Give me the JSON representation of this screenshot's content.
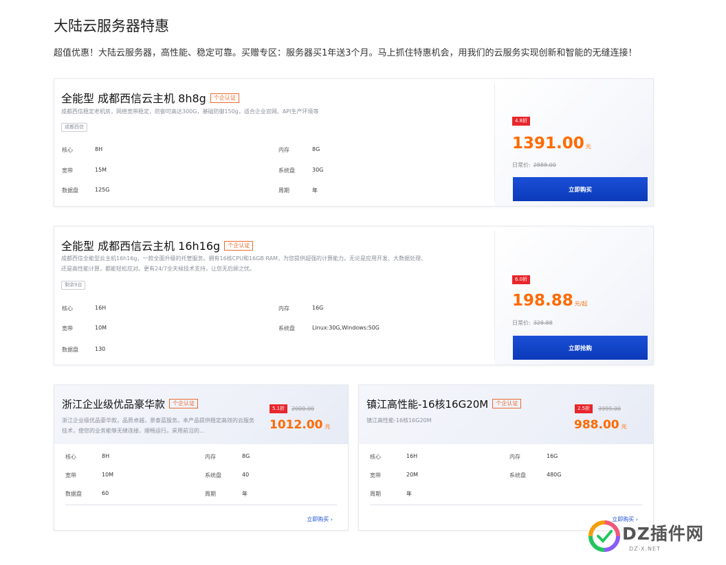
{
  "page": {
    "title": "大陆云服务器特惠",
    "subtitle": "超值优惠！大陆云服务器，高性能、稳定可靠。买赠专区：服务器买1年送3个月。马上抓住特惠机会，用我们的云服务实现创新和智能的无缝连接！"
  },
  "products": [
    {
      "name": "全能型 成都西信云主机 8h8g",
      "badge": "个企认证",
      "desc": "成都西信稳定老机房，网络宽带稳定，防御可高达300G，基础防御150g，适合企业官网、API生产环境等",
      "tag": "成都西信",
      "specs": {
        "core_k": "核心",
        "core_v": "8H",
        "mem_k": "内存",
        "mem_v": "8G",
        "bw_k": "宽带",
        "bw_v": "15M",
        "sys_k": "系统盘",
        "sys_v": "30G",
        "data_k": "数据盘",
        "data_v": "125G",
        "period_k": "周期",
        "period_v": "年"
      },
      "discount": "4.8折",
      "price": "1391.00",
      "unit": "元",
      "orig_label": "日常价:",
      "orig_price": "2888.00",
      "buy": "立即购买"
    },
    {
      "name": "全能型 成都西信云主机 16h16g",
      "badge": "个企认证",
      "desc1": "成都西信全能型云主机16h16g，一款全面升级的托管服务。拥有16核CPU和16GB RAM，为您提供超强的计算能力。无论是应用开发、大数据处理、",
      "desc2": "还是高性能计算，都能轻松应对。更有24/7全天候技术支持，让您无后顾之忧。",
      "tag": "剩余9台",
      "specs": {
        "core_k": "核心",
        "core_v": "16H",
        "mem_k": "内存",
        "mem_v": "16G",
        "bw_k": "宽带",
        "bw_v": "10M",
        "sys_k": "系统盘",
        "sys_v": "Linux:30G,Windows:50G",
        "data_k": "数据盘",
        "data_v": "130"
      },
      "discount": "6.0折",
      "price": "198.88",
      "unit": "元/起",
      "orig_label": "日常价:",
      "orig_price": "328.88",
      "buy": "立即抢购"
    }
  ],
  "small_products": [
    {
      "name": "浙江企业级优品豪华款",
      "badge": "个企认证",
      "desc": "浙江企业级优品豪华款，品质卓越，景泰蓝服务。本产品提供稳定高效的云服务技术，使您的业务能够无缝连接，顺畅运行。采用前沿的...",
      "discount": "5.1折",
      "orig_price": "2000.00",
      "price": "1012.00",
      "unit": "元",
      "specs": {
        "core_k": "核心",
        "core_v": "8H",
        "mem_k": "内存",
        "mem_v": "8G",
        "bw_k": "宽带",
        "bw_v": "10M",
        "sys_k": "系统盘",
        "sys_v": "40",
        "data_k": "数据盘",
        "data_v": "60",
        "period_k": "周期",
        "period_v": "年"
      },
      "more": "立即购买 ›"
    },
    {
      "name": "镇江高性能-16核16G20M",
      "badge": "个企认证",
      "desc": "镇江高性能-16核16G20M",
      "discount": "2.5折",
      "orig_price": "3999.00",
      "price": "988.00",
      "unit": "元",
      "specs": {
        "core_k": "核心",
        "core_v": "16H",
        "mem_k": "内存",
        "mem_v": "16G",
        "bw_k": "宽带",
        "bw_v": "20M",
        "sys_k": "系统盘",
        "sys_v": "480G",
        "period_k": "周期",
        "period_v": "年"
      },
      "more": "立即购买 ›"
    }
  ],
  "watermark": {
    "text": "DZ插件网",
    "sub": "DZ-X.NET",
    "colors": [
      "#f05a78",
      "#8b5cf6",
      "#22c55e",
      "#f59e0b"
    ]
  }
}
